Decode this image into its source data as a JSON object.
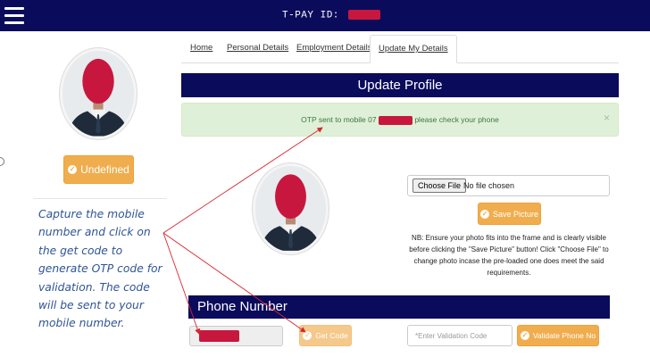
{
  "header": {
    "tpay_label": "T-PAY ID:",
    "menu_icon": "hamburger-icon",
    "redaction_color": "#c8173e"
  },
  "sidebar": {
    "status_button": {
      "label": "Undefined",
      "icon": "circle-check-icon"
    },
    "annotation": "Capture the mobile number and click on the get code to generate OTP code for validation. The code will be sent to your mobile number."
  },
  "tabs": [
    {
      "label": "Home",
      "active": false
    },
    {
      "label": "Personal Details",
      "active": false
    },
    {
      "label": "Employment Details",
      "active": false
    },
    {
      "label": "Update My Details",
      "active": true
    }
  ],
  "update_profile": {
    "title": "Update Profile",
    "alert": {
      "prefix": "OTP sent to mobile 07",
      "suffix": "please check your phone",
      "close": "×"
    },
    "file": {
      "button_label": "Choose File",
      "status": "No file chosen"
    },
    "save_button": {
      "label": "Save Picture",
      "icon": "circle-check-icon"
    },
    "note": "NB: Ensure your photo fits into the frame and is clearly visible before clicking the \"Save Picture\" button! Click \"Choose File\" to change photo incase the pre-loaded one does meet the said requirements."
  },
  "phone": {
    "title": "Phone Number",
    "get_code_button": {
      "label": "Get Code",
      "icon": "circle-check-icon"
    },
    "validation_placeholder": "*Enter Validation Code",
    "validate_button": {
      "label": "Validate Phone No",
      "icon": "circle-check-icon"
    }
  },
  "colors": {
    "navy": "#0b0b5c",
    "orange": "#f0ad4e",
    "alert_bg": "#dff0d8",
    "alert_text": "#3c763d",
    "annotation_text": "#2f5496",
    "arrow": "#d9262e"
  }
}
